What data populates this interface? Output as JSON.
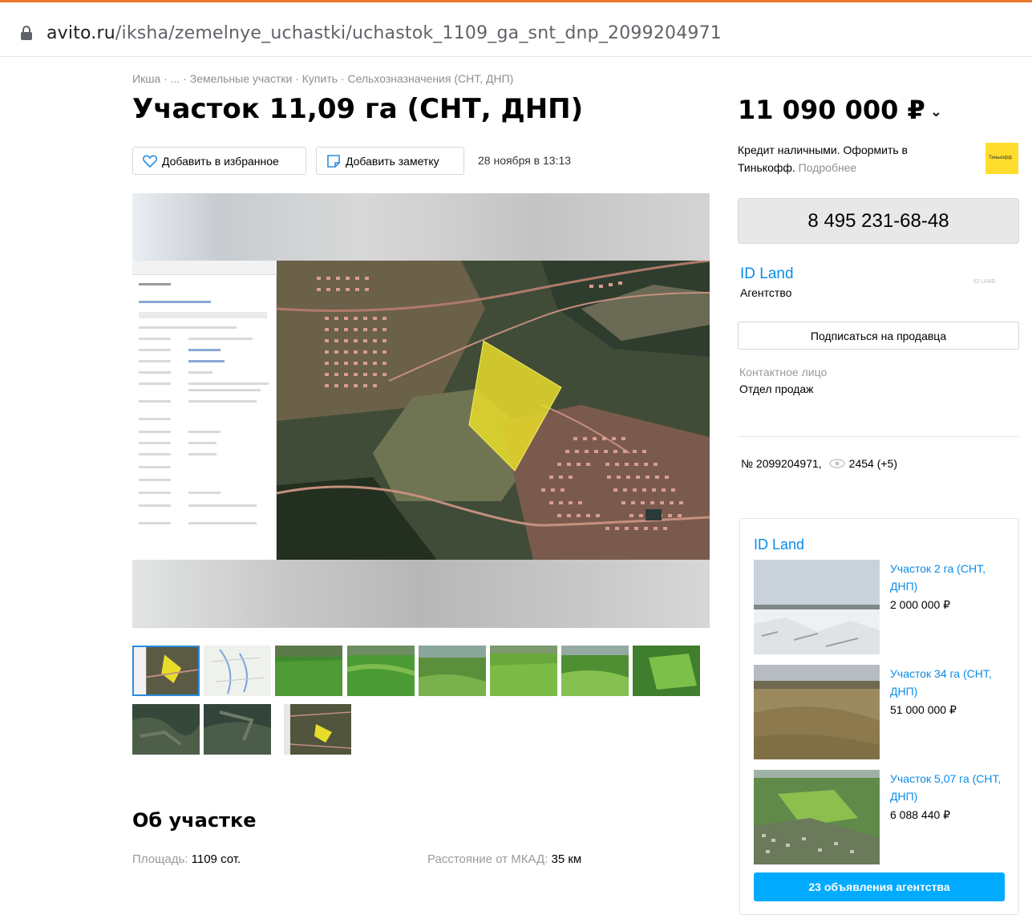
{
  "browser": {
    "url_host": "avito.ru",
    "url_path": "/iksha/zemelnye_uchastki/uchastok_1109_ga_snt_dnp_2099204971"
  },
  "breadcrumb": "Икша · ... · Земельные участки · Купить · Сельхозназначения (СНТ, ДНП)",
  "listing": {
    "title": "Участок 11,09 га (СНТ, ДНП)",
    "price": "11 090 000 ₽",
    "favorite_label": "Добавить в избранное",
    "note_label": "Добавить заметку",
    "date": "28 ноября в 13:13",
    "about_heading": "Об участке",
    "params": [
      {
        "label": "Площадь:",
        "value": "1109 сот."
      },
      {
        "label": "Расстояние от МКАД:",
        "value": "35 км"
      }
    ]
  },
  "credit": {
    "text": "Кредит наличными. Оформить в Тинькофф.",
    "more": "Подробнее",
    "logo_text": "Тинькофф"
  },
  "seller": {
    "phone": "8 495 231-68-48",
    "name": "ID Land",
    "type": "Агентство",
    "logo_text": "ID LAND",
    "subscribe_label": "Подписаться на продавца",
    "contact_label": "Контактное лицо",
    "contact_value": "Отдел продаж"
  },
  "stats": {
    "ad_number": "№ 2099204971,",
    "views": "2454 (+5)"
  },
  "agency_block": {
    "name": "ID Land",
    "items": [
      {
        "title": "Участок 2 га (СНТ, ДНП)",
        "price": "2 000 000 ₽"
      },
      {
        "title": "Участок 34 га (СНТ, ДНП)",
        "price": "51 000 000 ₽"
      },
      {
        "title": "Участок 5,07 га (СНТ, ДНП)",
        "price": "6 088 440 ₽"
      }
    ],
    "all_label": "23 объявления агентства"
  },
  "colors": {
    "accent": "#0a8ce8",
    "button_blue": "#00aaff",
    "tinkoff_yellow": "#ffdd2d",
    "plot_yellow": "#e8dc2a"
  }
}
